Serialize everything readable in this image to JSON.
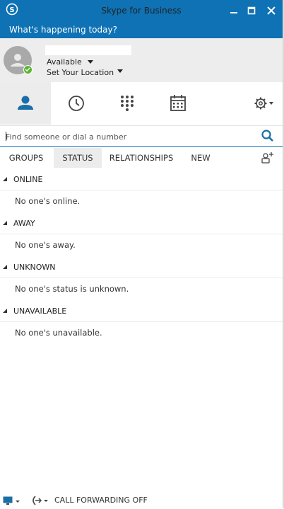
{
  "window": {
    "title": "Skype for Business",
    "minimize_icon": "minimize-icon",
    "maximize_icon": "maximize-icon",
    "close_icon": "close-icon"
  },
  "header": {
    "whats_happening": "What's happening today?"
  },
  "presence": {
    "availability": "Available",
    "location": "Set Your Location",
    "status_color": "#5bb435"
  },
  "nav": {
    "items": [
      {
        "name": "contacts",
        "icon": "person-icon",
        "active": true
      },
      {
        "name": "conversations",
        "icon": "clock-icon"
      },
      {
        "name": "phone",
        "icon": "dialpad-icon"
      },
      {
        "name": "meetings",
        "icon": "calendar-icon"
      },
      {
        "name": "options",
        "icon": "gear-icon"
      }
    ]
  },
  "search": {
    "placeholder": "Find someone or dial a number"
  },
  "tabs": [
    {
      "label": "GROUPS"
    },
    {
      "label": "STATUS",
      "active": true
    },
    {
      "label": "RELATIONSHIPS"
    },
    {
      "label": "NEW"
    }
  ],
  "groups": [
    {
      "label": "ONLINE",
      "message": "No one's online."
    },
    {
      "label": "AWAY",
      "message": "No one's away."
    },
    {
      "label": "UNKNOWN",
      "message": "No one's status is unknown."
    },
    {
      "label": "UNAVAILABLE",
      "message": "No one's unavailable."
    }
  ],
  "footer": {
    "call_forwarding": "CALL FORWARDING OFF"
  },
  "colors": {
    "brand": "#0e72b5",
    "accent_icon": "#1a6fa8"
  }
}
